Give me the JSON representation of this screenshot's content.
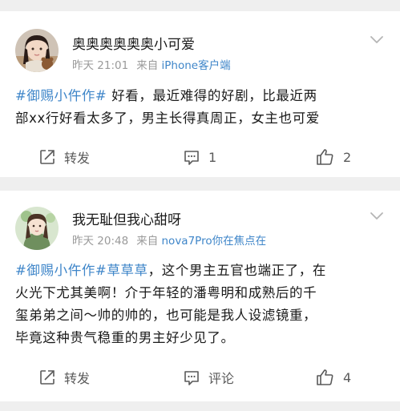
{
  "colors": {
    "link": "#3f86c9",
    "meta_text": "#9a9a9a",
    "body_text": "#1a1a1a",
    "background": "#efefef"
  },
  "posts": [
    {
      "username": "奥奥奥奥奥奥小可爱",
      "time": "昨天 21:01",
      "from_label": "来自",
      "device": "iPhone客户端",
      "avatar_icon": "avatar-girl-photo",
      "lines": [
        [
          {
            "text": "#御赐小仵作#",
            "topic": true
          },
          {
            "text": " 好看，最近难得的好剧，比最近两",
            "topic": false
          }
        ],
        [
          {
            "text": "部xx行好看太多了，男主长得真周正，女主也可爱",
            "topic": false
          }
        ]
      ],
      "actions": {
        "share": "转发",
        "comment": "1",
        "like": "2"
      }
    },
    {
      "username": "我无耻但我心甜呀",
      "time": "昨天 20:48",
      "from_label": "来自",
      "device": "nova7Pro你在焦点在",
      "avatar_icon": "avatar-illustrated-girl",
      "lines": [
        [
          {
            "text": "#御赐小仵作#",
            "topic": true
          },
          {
            "text": "草草草",
            "topic": true
          },
          {
            "text": "，这个男主五官也端正了，在",
            "topic": false
          }
        ],
        [
          {
            "text": "火光下尤其美啊！介于年轻的潘粤明和成熟后的千",
            "topic": false
          }
        ],
        [
          {
            "text": "玺弟弟之间～帅的帅的，也可能是我人设滤镜重，",
            "topic": false
          }
        ],
        [
          {
            "text": "毕竟这种贵气稳重的男主好少见了。",
            "topic": false
          }
        ]
      ],
      "actions": {
        "share": "转发",
        "comment": "评论",
        "like": "4"
      }
    }
  ]
}
